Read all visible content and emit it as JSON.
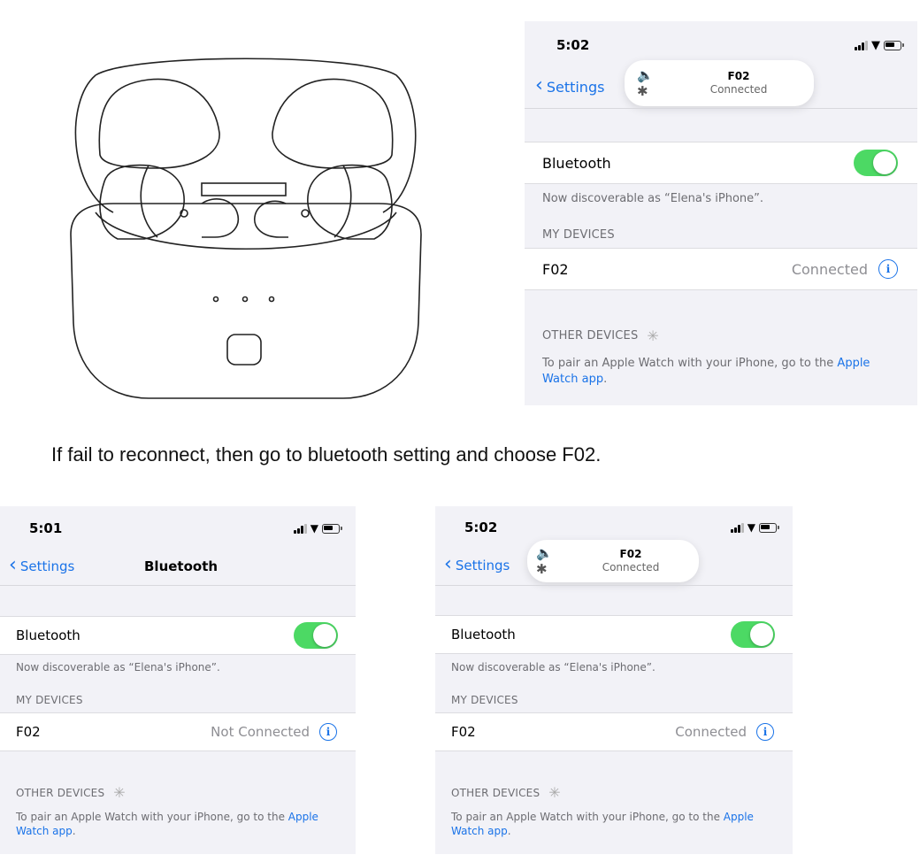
{
  "caption": "If fail to reconnect, then go to bluetooth setting and choose F02.",
  "colors": {
    "accent": "#1a73e8",
    "toggle_on": "#4cd964",
    "background": "#f2f2f7"
  },
  "screens": [
    {
      "time": "5:02",
      "back_label": "Settings",
      "toast": {
        "name": "F02",
        "status": "Connected"
      },
      "bluetooth_label": "Bluetooth",
      "bluetooth_on": true,
      "discoverable": "Now discoverable as “Elena's iPhone”.",
      "my_devices_header": "MY DEVICES",
      "device": {
        "name": "F02",
        "status": "Connected"
      },
      "other_devices_header": "OTHER DEVICES",
      "footer_text": "To pair an Apple Watch with your iPhone, go to the ",
      "footer_link": "Apple Watch app",
      "footer_end": "."
    },
    {
      "time": "5:01",
      "back_label": "Settings",
      "title": "Bluetooth",
      "bluetooth_label": "Bluetooth",
      "bluetooth_on": true,
      "discoverable": "Now discoverable as “Elena's iPhone”.",
      "my_devices_header": "MY DEVICES",
      "device": {
        "name": "F02",
        "status": "Not Connected"
      },
      "other_devices_header": "OTHER DEVICES",
      "footer_text": "To pair an Apple Watch with your iPhone, go to the ",
      "footer_link": "Apple Watch app",
      "footer_end": "."
    },
    {
      "time": "5:02",
      "back_label": "Settings",
      "toast": {
        "name": "F02",
        "status": "Connected"
      },
      "bluetooth_label": "Bluetooth",
      "bluetooth_on": true,
      "discoverable": "Now discoverable as “Elena's iPhone”.",
      "my_devices_header": "MY DEVICES",
      "device": {
        "name": "F02",
        "status": "Connected"
      },
      "other_devices_header": "OTHER DEVICES",
      "footer_text": "To pair an Apple Watch with your iPhone, go to the ",
      "footer_link": "Apple Watch app",
      "footer_end": "."
    }
  ]
}
